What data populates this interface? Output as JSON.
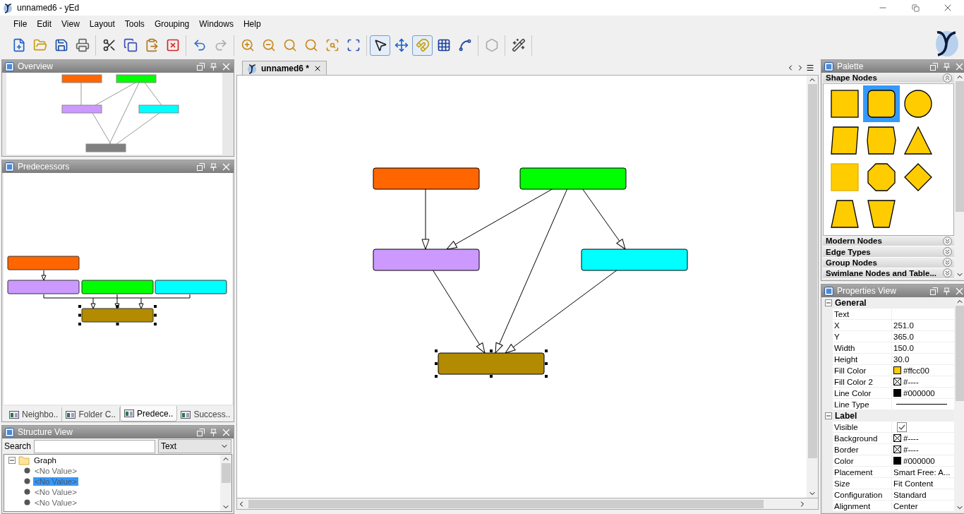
{
  "window": {
    "title": "unnamed6 - yEd"
  },
  "menu": [
    "File",
    "Edit",
    "View",
    "Layout",
    "Tools",
    "Grouping",
    "Windows",
    "Help"
  ],
  "toolbar": [
    [
      {
        "pressed": false,
        "disabled": false
      },
      {
        "pressed": false,
        "disabled": false
      },
      {
        "pressed": false,
        "disabled": false
      },
      {
        "pressed": false,
        "disabled": false
      }
    ],
    [
      {
        "pressed": false,
        "disabled": false
      },
      {
        "pressed": false,
        "disabled": false
      },
      {
        "pressed": false,
        "disabled": false
      },
      {
        "pressed": false,
        "disabled": false
      }
    ],
    [
      {
        "pressed": false,
        "disabled": false
      },
      {
        "pressed": false,
        "disabled": true
      }
    ],
    [
      {
        "pressed": false,
        "disabled": false
      },
      {
        "pressed": false,
        "disabled": false
      },
      {
        "pressed": false,
        "disabled": false
      },
      {
        "pressed": false,
        "disabled": false
      },
      {
        "pressed": false,
        "disabled": false
      },
      {
        "pressed": false,
        "disabled": false
      }
    ],
    [
      {
        "pressed": true,
        "disabled": false
      },
      {
        "pressed": false,
        "disabled": false
      },
      {
        "pressed": true,
        "disabled": false
      },
      {
        "pressed": false,
        "disabled": false
      },
      {
        "pressed": false,
        "disabled": false
      }
    ],
    [
      {
        "pressed": false,
        "disabled": true
      }
    ],
    [
      {
        "pressed": false,
        "disabled": false
      }
    ]
  ],
  "overview": {
    "title": "Overview",
    "nodes": [
      {
        "color": "#ff6600"
      },
      {
        "color": "#00ff00"
      },
      {
        "color": "#cc99ff"
      },
      {
        "color": "#00ffff"
      },
      {
        "color": "#808080"
      }
    ]
  },
  "predecessors": {
    "title": "Predecessors",
    "nodes": [
      {
        "color": "#ff6600",
        "selected": false
      },
      {
        "color": "#cc99ff",
        "selected": false
      },
      {
        "color": "#00ff00",
        "selected": false
      },
      {
        "color": "#00ffff",
        "selected": false
      },
      {
        "color": "#b38b00",
        "selected": true
      }
    ]
  },
  "dock_tabs": [
    {
      "label": "Neighbo..",
      "selected": false
    },
    {
      "label": "Folder C..",
      "selected": false
    },
    {
      "label": "Predece..",
      "selected": true
    },
    {
      "label": "Success..",
      "selected": false
    }
  ],
  "structure_view": {
    "title": "Structure View",
    "search_label": "Search",
    "filter": "Text",
    "tree": [
      {
        "label": "Graph",
        "expanded": true,
        "children": [
          {
            "label": "<No Value>",
            "selected": false
          },
          {
            "label": "<No Value>",
            "selected": true
          },
          {
            "label": "<No Value>",
            "selected": false
          },
          {
            "label": "<No Value>",
            "selected": false
          }
        ]
      }
    ]
  },
  "document_tab": {
    "label": "unnamed6 *",
    "selected": true
  },
  "graph": {
    "nodes": [
      {
        "color": "#ff6600",
        "selected": false
      },
      {
        "color": "#00ff00",
        "selected": false
      },
      {
        "color": "#cc99ff",
        "selected": false
      },
      {
        "color": "#00ffff",
        "selected": false
      },
      {
        "color": "#b38b00",
        "selected": true
      }
    ]
  },
  "palette": {
    "title": "Palette",
    "sections": [
      {
        "label": "Shape Nodes",
        "expanded": true,
        "shapes": [
          {
            "kind": "rectangle",
            "selected": false
          },
          {
            "kind": "roundrect",
            "selected": true
          },
          {
            "kind": "ellipse",
            "selected": false
          },
          {
            "kind": "parallelogram",
            "selected": false
          },
          {
            "kind": "hexagon",
            "selected": false
          },
          {
            "kind": "triangle",
            "selected": false
          },
          {
            "kind": "rectangle3d",
            "selected": false
          },
          {
            "kind": "octagon",
            "selected": false
          },
          {
            "kind": "diamond",
            "selected": false
          },
          {
            "kind": "trapezoid",
            "selected": false
          },
          {
            "kind": "trapezoid2",
            "selected": false
          }
        ]
      },
      {
        "label": "Modern Nodes",
        "expanded": false
      },
      {
        "label": "Edge Types",
        "expanded": false
      },
      {
        "label": "Group Nodes",
        "expanded": false
      },
      {
        "label": "Swimlane Nodes and Table...",
        "expanded": false
      }
    ]
  },
  "properties": {
    "title": "Properties View",
    "groups": [
      {
        "label": "General",
        "expanded": true,
        "rows": [
          {
            "name": "Text",
            "kind": "text"
          },
          {
            "name": "X",
            "kind": "text",
            "value": "251.0"
          },
          {
            "name": "Y",
            "kind": "text",
            "value": "365.0"
          },
          {
            "name": "Width",
            "kind": "text",
            "value": "150.0"
          },
          {
            "name": "Height",
            "kind": "text",
            "value": "30.0"
          },
          {
            "name": "Fill Color",
            "kind": "color",
            "color": "#ffcc00",
            "value": "#ffcc00"
          },
          {
            "name": "Fill Color 2",
            "kind": "none",
            "value": "#----"
          },
          {
            "name": "Line Color",
            "kind": "color",
            "color": "#000000",
            "value": "#000000"
          },
          {
            "name": "Line Type",
            "kind": "line"
          }
        ]
      },
      {
        "label": "Label",
        "expanded": true,
        "rows": [
          {
            "name": "Visible",
            "kind": "check",
            "checked": true
          },
          {
            "name": "Background",
            "kind": "none",
            "value": "#----"
          },
          {
            "name": "Border",
            "kind": "none",
            "value": "#----"
          },
          {
            "name": "Color",
            "kind": "color",
            "color": "#000000",
            "value": "#000000"
          },
          {
            "name": "Placement",
            "kind": "text",
            "value": "Smart Free: A..."
          },
          {
            "name": "Size",
            "kind": "text",
            "value": "Fit Content"
          },
          {
            "name": "Configuration",
            "kind": "text",
            "value": "Standard"
          },
          {
            "name": "Alignment",
            "kind": "text",
            "value": "Center"
          }
        ]
      }
    ]
  }
}
